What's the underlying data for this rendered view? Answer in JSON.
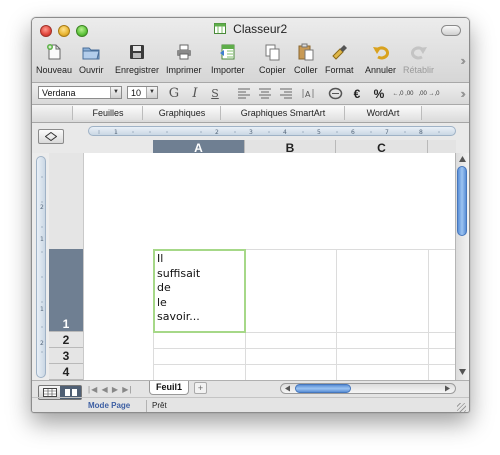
{
  "window": {
    "title": "Classeur2"
  },
  "toolbar": {
    "buttons": [
      {
        "label": "Nouveau",
        "icon": "new-document-icon",
        "enabled": true
      },
      {
        "label": "Ouvrir",
        "icon": "open-folder-icon",
        "enabled": true
      },
      {
        "label": "Enregistrer",
        "icon": "save-disk-icon",
        "enabled": true
      },
      {
        "label": "Imprimer",
        "icon": "printer-icon",
        "enabled": true
      },
      {
        "label": "Importer",
        "icon": "import-icon",
        "enabled": true
      },
      {
        "label": "Copier",
        "icon": "copy-icon",
        "enabled": true
      },
      {
        "label": "Coller",
        "icon": "paste-icon",
        "enabled": true
      },
      {
        "label": "Format",
        "icon": "format-brush-icon",
        "enabled": true
      },
      {
        "label": "Annuler",
        "icon": "undo-icon",
        "enabled": true
      },
      {
        "label": "Rétablir",
        "icon": "redo-icon",
        "enabled": false
      }
    ]
  },
  "format_bar": {
    "font_name": "Verdana",
    "font_size": "10",
    "bold_glyph": "G",
    "italic_glyph": "I",
    "underline_glyph": "S",
    "currency_glyph": "€",
    "percent_glyph": "%",
    "inc_decimal_glyph": "←,0 ,00",
    "dec_decimal_glyph": ",00 →,0"
  },
  "galerie_tabs": [
    "Feuilles",
    "Graphiques",
    "Graphiques SmartArt",
    "WordArt"
  ],
  "columns": [
    "A",
    "B",
    "C"
  ],
  "rows": [
    "1",
    "2",
    "3",
    "4"
  ],
  "cell_A1": {
    "text": "Il\nsuffisait\nde\nle\nsavoir..."
  },
  "sheet_tabs": [
    "Feuil1"
  ],
  "add_sheet_label": "+",
  "status_bar": {
    "view_mode": "Mode Page",
    "status": "Prêt"
  },
  "colors": {
    "selected_header": "#6f7f92",
    "selection_border": "#a6d888",
    "scroll_thumb": "#5b8fd6"
  }
}
